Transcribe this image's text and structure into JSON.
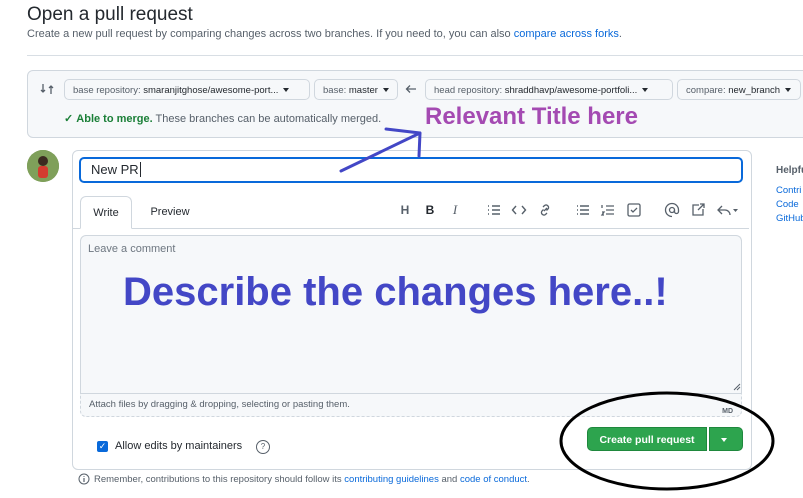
{
  "header": {
    "title": "Open a pull request",
    "subtitle_prefix": "Create a new pull request by comparing changes across two branches. If you need to, you can also",
    "subtitle_link": "compare across forks",
    "subtitle_suffix": "."
  },
  "compare": {
    "base_repo_label": "base repository:",
    "base_repo_value": "smaranjitghose/awesome-port...",
    "base_label": "base:",
    "base_value": "master",
    "head_repo_label": "head repository:",
    "head_repo_value": "shraddhavp/awesome-portfoli...",
    "compare_label": "compare:",
    "compare_value": "new_branch",
    "merge_ok": "Able to merge.",
    "merge_text": "These branches can be automatically merged."
  },
  "form": {
    "title_value": "New PR",
    "tabs": [
      "Write",
      "Preview"
    ],
    "comment_placeholder": "Leave a comment",
    "attach_text": "Attach files by dragging & dropping, selecting or pasting them.",
    "md_badge": "MD",
    "allow_edits_label": "Allow edits by maintainers",
    "help_glyph": "?",
    "create_button": "Create pull request"
  },
  "footer": {
    "prefix": "Remember, contributions to this repository should follow its",
    "link1": "contributing guidelines",
    "middle": "and",
    "link2": "code of conduct",
    "suffix": "."
  },
  "sidebar": {
    "heading": "Helpfu",
    "links": [
      "Contri",
      "Code",
      "GitHub"
    ]
  },
  "annotations": {
    "title_hint": "Relevant Title here",
    "body_hint": "Describe the changes here..!"
  },
  "colors": {
    "accent": "#0969da",
    "create_button": "#2da44e",
    "annotation_title": "#a44ab2",
    "annotation_body": "#4347c6"
  },
  "icons": [
    "compare-arrows-icon",
    "arrow-left-icon",
    "check-icon",
    "heading-icon",
    "bold-icon",
    "italic-icon",
    "quote-icon",
    "code-icon",
    "link-icon",
    "bullet-list-icon",
    "numbered-list-icon",
    "task-list-icon",
    "mention-icon",
    "reference-icon",
    "reply-icon",
    "info-icon"
  ]
}
